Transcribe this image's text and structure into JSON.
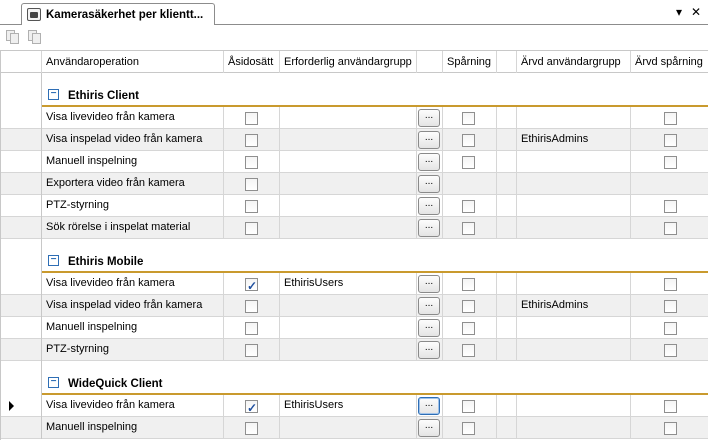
{
  "window": {
    "tab_title": "Kamerasäkerhet per klientt...",
    "dropdown_glyph": "▾",
    "close_glyph": "✕"
  },
  "columns": {
    "operation": "Användaroperation",
    "override": "Åsidosätt",
    "required_group": "Erforderlig användargrupp",
    "tracking": "Spårning",
    "inherited_group": "Ärvd användargrupp",
    "inherited_tracking": "Ärvd spårning"
  },
  "dots_label": "...",
  "groups": [
    {
      "title": "Ethiris Client",
      "toggle": "−",
      "rows": [
        {
          "operation": "Visa livevideo från kamera",
          "override": false,
          "required_group": "",
          "tracking_box": true,
          "inherited_group": "",
          "inherited_tracking_box": true
        },
        {
          "operation": "Visa inspelad video från kamera",
          "override": false,
          "required_group": "",
          "tracking_box": true,
          "inherited_group": "EthirisAdmins",
          "inherited_tracking_box": true
        },
        {
          "operation": "Manuell inspelning",
          "override": false,
          "required_group": "",
          "tracking_box": true,
          "inherited_group": "",
          "inherited_tracking_box": true
        },
        {
          "operation": "Exportera video från kamera",
          "override": false,
          "required_group": "",
          "tracking_box": false,
          "inherited_group": "",
          "inherited_tracking_box": false
        },
        {
          "operation": "PTZ-styrning",
          "override": false,
          "required_group": "",
          "tracking_box": true,
          "inherited_group": "",
          "inherited_tracking_box": true
        },
        {
          "operation": "Sök rörelse i inspelat material",
          "override": false,
          "required_group": "",
          "tracking_box": true,
          "inherited_group": "",
          "inherited_tracking_box": true
        }
      ]
    },
    {
      "title": "Ethiris Mobile",
      "toggle": "−",
      "rows": [
        {
          "operation": "Visa livevideo från kamera",
          "override": true,
          "required_group": "EthirisUsers",
          "tracking_box": true,
          "inherited_group": "",
          "inherited_tracking_box": true
        },
        {
          "operation": "Visa inspelad video från kamera",
          "override": false,
          "required_group": "",
          "tracking_box": true,
          "inherited_group": "EthirisAdmins",
          "inherited_tracking_box": true
        },
        {
          "operation": "Manuell inspelning",
          "override": false,
          "required_group": "",
          "tracking_box": true,
          "inherited_group": "",
          "inherited_tracking_box": true
        },
        {
          "operation": "PTZ-styrning",
          "override": false,
          "required_group": "",
          "tracking_box": true,
          "inherited_group": "",
          "inherited_tracking_box": true
        }
      ]
    },
    {
      "title": "WideQuick Client",
      "toggle": "−",
      "rows": [
        {
          "operation": "Visa livevideo från kamera",
          "override": true,
          "required_group": "EthirisUsers",
          "tracking_box": true,
          "inherited_group": "",
          "inherited_tracking_box": true,
          "current": true
        },
        {
          "operation": "Manuell inspelning",
          "override": false,
          "required_group": "",
          "tracking_box": true,
          "inherited_group": "",
          "inherited_tracking_box": true
        }
      ]
    }
  ],
  "colors": {
    "group_line": "#c99a2e",
    "toggle": "#2e6eb5",
    "alt_row": "#f0f0f0",
    "check": "#1f4f9e"
  }
}
